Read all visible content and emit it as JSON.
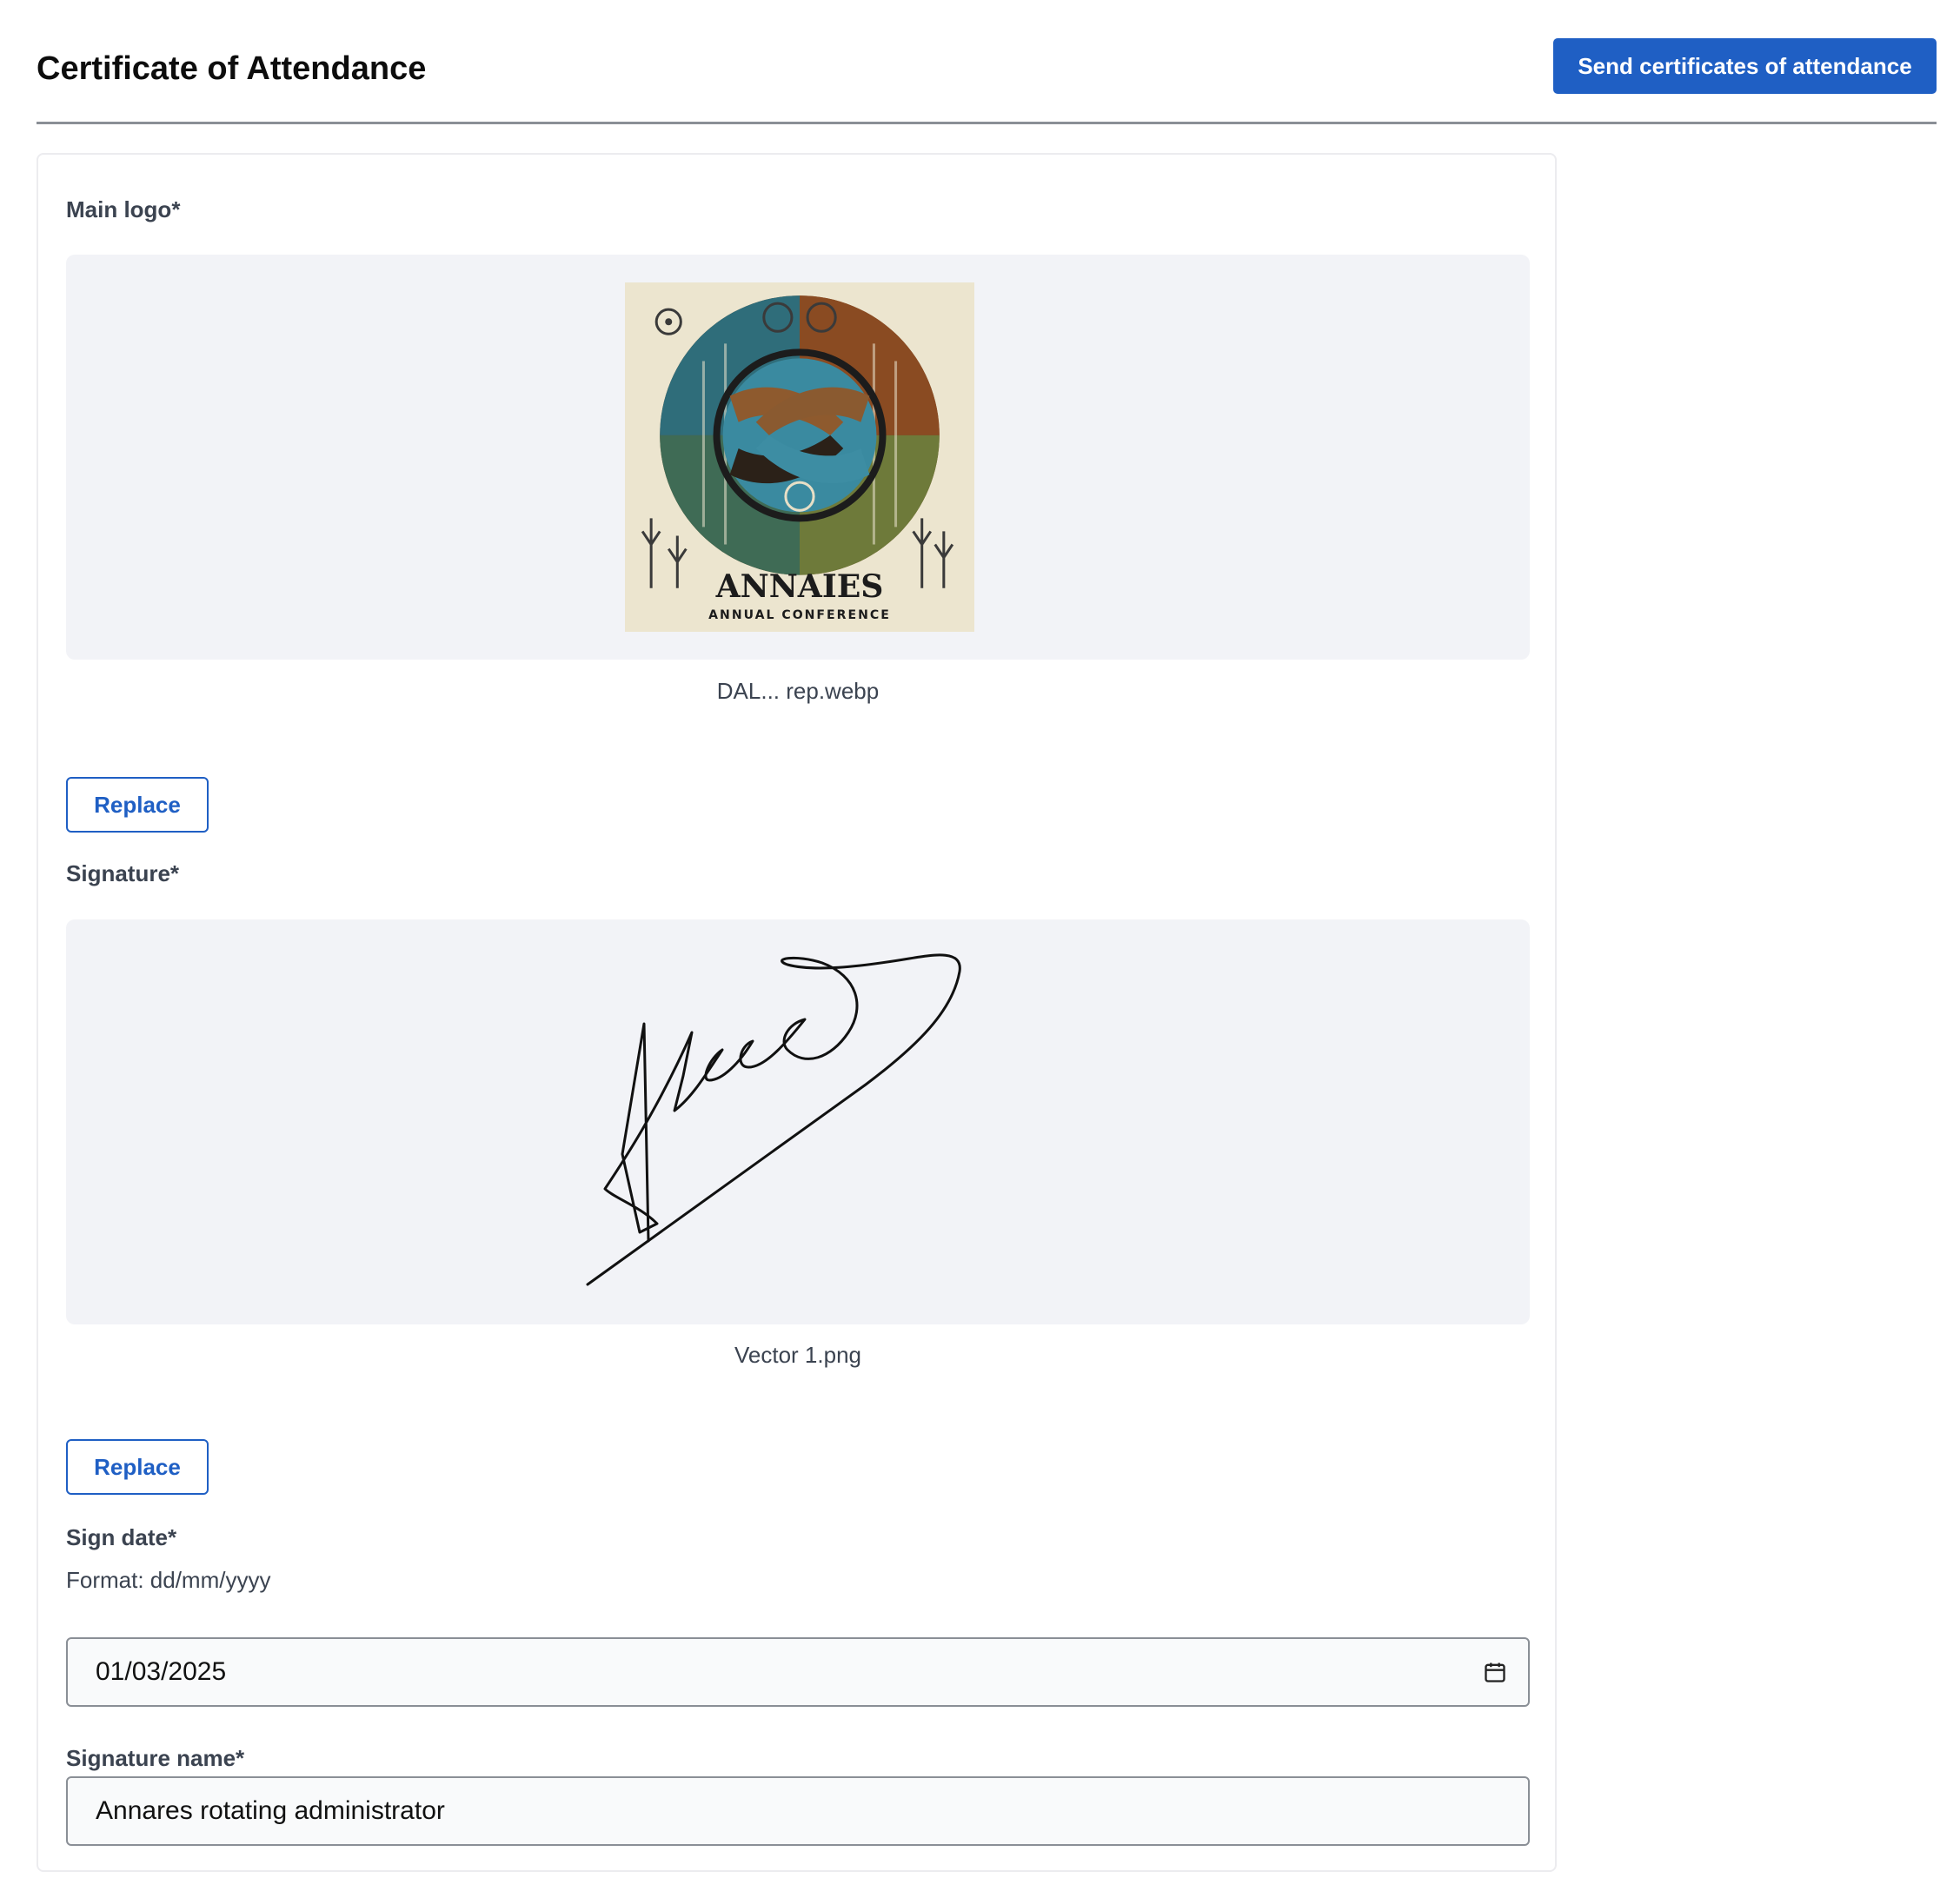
{
  "header": {
    "title": "Certificate of Attendance",
    "send_button_label": "Send certificates of attendance"
  },
  "main_logo": {
    "label": "Main logo*",
    "file_name": "DAL... rep.webp",
    "replace_label": "Replace",
    "logo_text": "ANNAIES",
    "logo_subtext": "ANNUAL CONFERENCE"
  },
  "signature": {
    "label": "Signature*",
    "file_name": "Vector 1.png",
    "replace_label": "Replace"
  },
  "sign_date": {
    "label": "Sign date*",
    "help": "Format: dd/mm/yyyy",
    "value": "01/03/2025",
    "icon": "calendar-icon"
  },
  "signature_name": {
    "label": "Signature name*",
    "value": "Annares rotating administrator"
  },
  "colors": {
    "primary": "#1f5fc4",
    "preview_bg": "#f2f3f7",
    "label_text": "#3b4350"
  }
}
